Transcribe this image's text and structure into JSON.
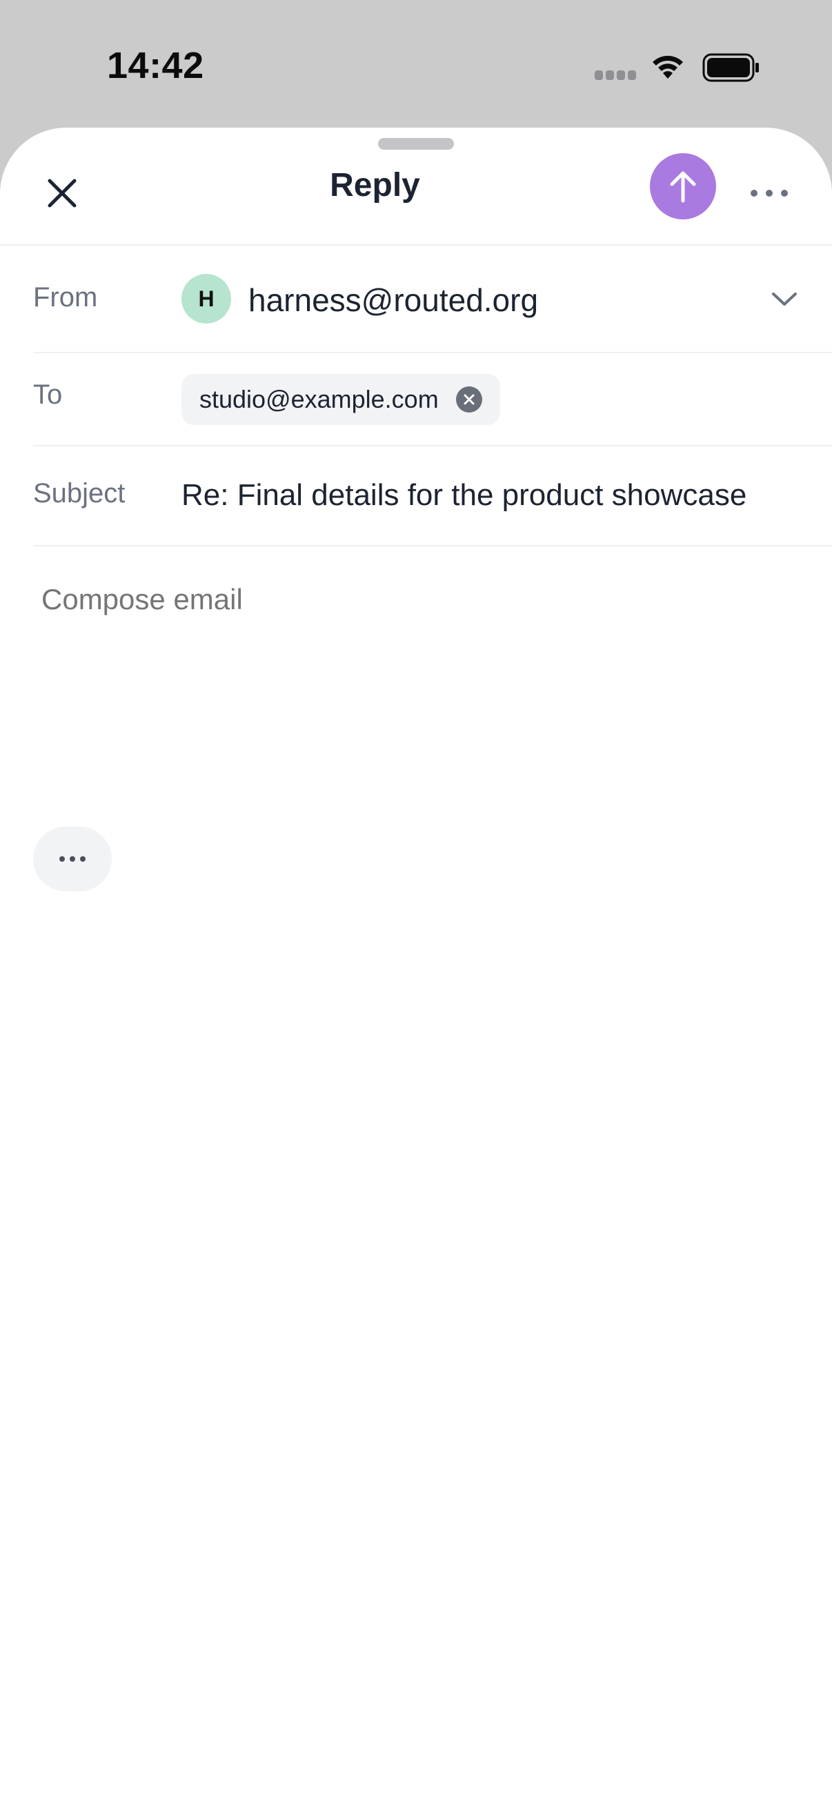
{
  "status_bar": {
    "time": "14:42",
    "icons": [
      "signal-icon",
      "wifi-icon",
      "battery-icon"
    ]
  },
  "header": {
    "title": "Reply",
    "close_icon": "close-icon",
    "send_icon": "arrow-up-icon",
    "more_icon": "more-horizontal-icon",
    "accent_color": "#a97ae0"
  },
  "fields": {
    "from": {
      "label": "From",
      "avatar_initial": "H",
      "address": "harness@routed.org"
    },
    "to": {
      "label": "To",
      "recipients": [
        "studio@example.com"
      ]
    },
    "subject": {
      "label": "Subject",
      "value": "Re: Final details for the product showcase"
    }
  },
  "compose": {
    "placeholder": "Compose email",
    "value": ""
  }
}
